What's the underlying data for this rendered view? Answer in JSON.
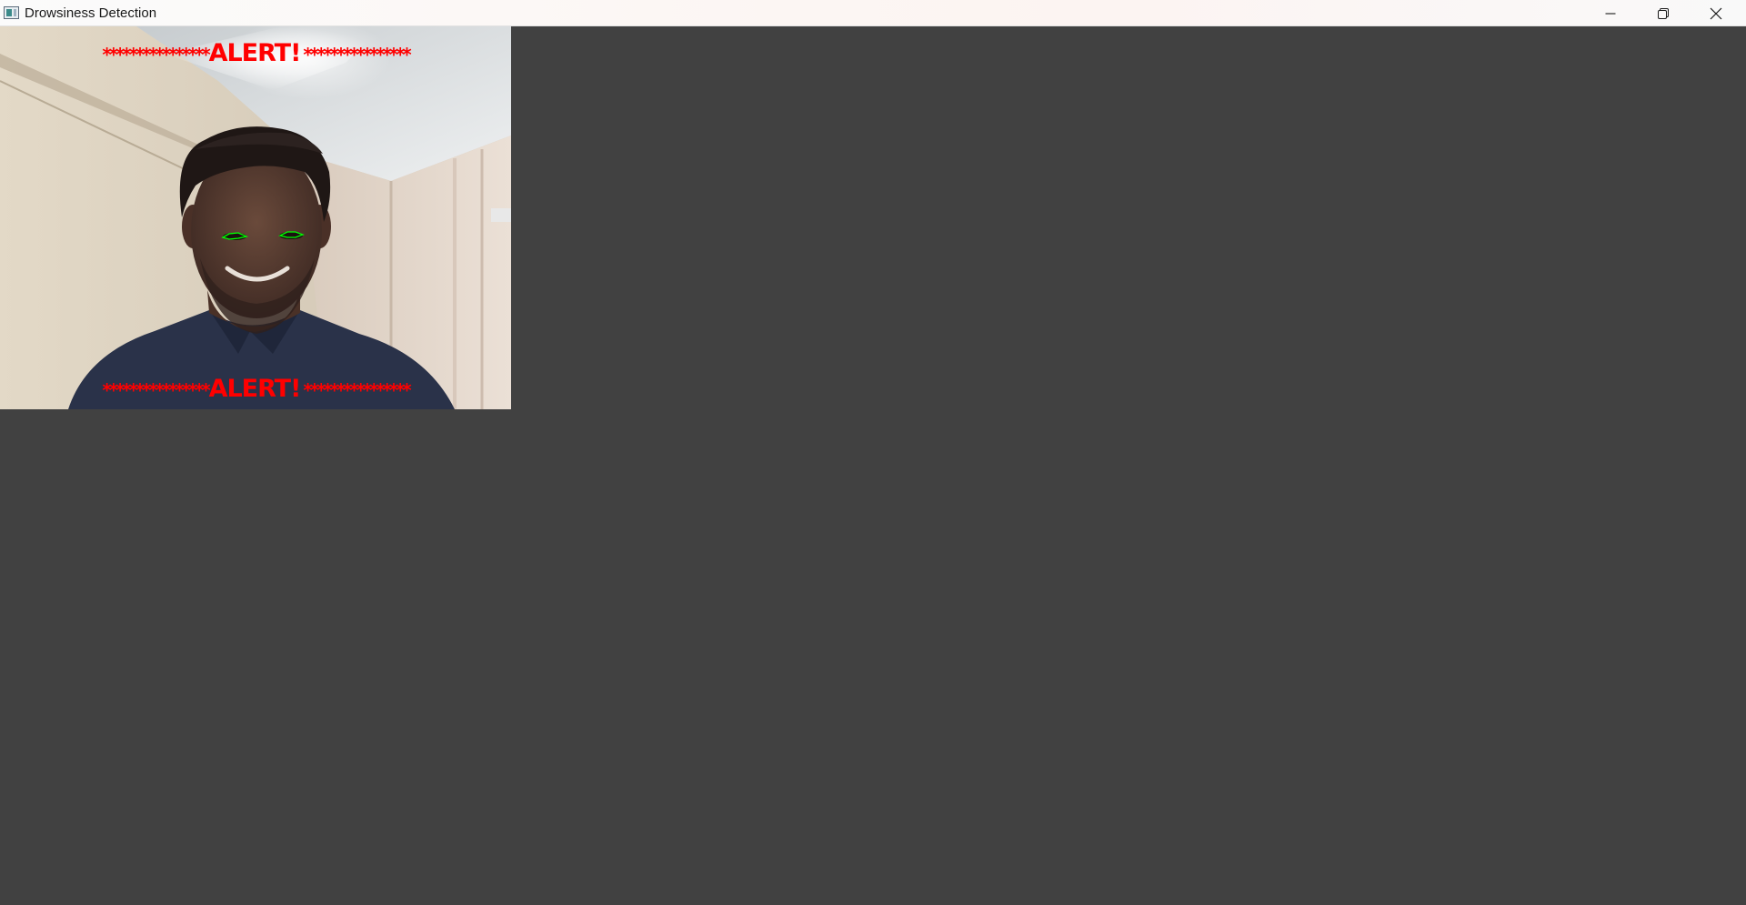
{
  "window": {
    "title": "Drowsiness Detection",
    "controls": {
      "minimize": "minimize-icon",
      "restore": "restore-icon",
      "close": "close-icon"
    }
  },
  "video": {
    "alert_top": {
      "stars_left": "****************",
      "text": "ALERT!",
      "stars_right": "****************"
    },
    "alert_bottom": {
      "stars_left": "****************",
      "text": "ALERT!",
      "stars_right": "****************"
    },
    "alert_color": "#ff0000",
    "eye_contour_color": "#00ff00"
  },
  "colors": {
    "background": "#414141",
    "titlebar": "#fbfbfb"
  }
}
